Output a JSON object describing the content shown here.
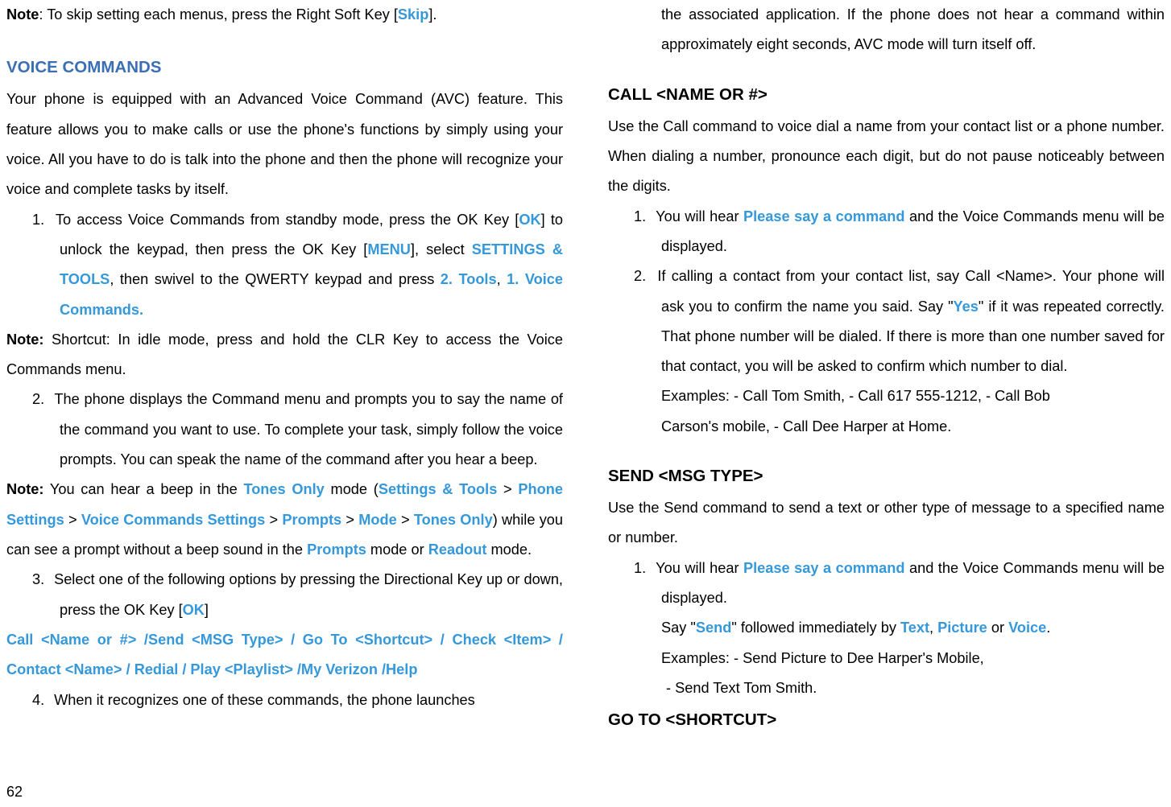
{
  "left": {
    "note1_label": "Note",
    "note1_rest": ": To skip setting each menus, press the Right Soft Key [",
    "note1_skip": "Skip",
    "note1_end": "].",
    "h_voice": "VOICE COMMANDS",
    "intro": "Your phone is equipped with an Advanced Voice Command (AVC) feature. This feature allows you to make calls or use the phone's functions by simply using your voice. All you have to do is talk into the phone and then the phone will recognize your voice and complete tasks by itself.",
    "li1_num": "1.",
    "li1_a": "To access Voice Commands from standby mode, press the OK Key [",
    "li1_ok": "OK",
    "li1_b": "] to unlock the keypad, then press the OK Key [",
    "li1_menu": "MENU",
    "li1_c": "], select ",
    "li1_settings": "SETTINGS & TOOLS",
    "li1_d": ", then swivel to the QWERTY keypad and press ",
    "li1_tools": "2. Tools",
    "li1_comma": ", ",
    "li1_vc": "1. Voice Commands.",
    "note2_label": "Note:",
    "note2_rest": " Shortcut: In idle mode, press and hold the CLR Key to access the Voice Commands menu.",
    "li2_num": "2.",
    "li2_text": "The phone displays the Command menu and prompts you to say the name of the command you want to use. To complete your task, simply follow the voice prompts. You can speak the name of the command after you hear a beep.",
    "note3_label": "Note:",
    "note3_a": " You can hear a beep in the ",
    "note3_tones1": "Tones Only",
    "note3_b": " mode (",
    "note3_st": "Settings & Tools",
    "note3_gt1": " > ",
    "note3_ps": "Phone Settings",
    "note3_gt2": " > ",
    "note3_vcs": "Voice Commands Settings",
    "note3_gt3": " > ",
    "note3_pr": "Prompts",
    "note3_gt4": " > ",
    "note3_mode": "Mode",
    "note3_gt5": " > ",
    "note3_tones2": "Tones Only",
    "note3_c": ") while you can see a prompt without a beep sound in the ",
    "note3_prompts2": "Prompts",
    "note3_d": " mode or ",
    "note3_readout": "Readout",
    "note3_e": " mode.",
    "li3_num": "3.",
    "li3_a": "Select one of the following options by pressing the Directional Key up or down, press the OK Key [",
    "li3_ok": "OK",
    "li3_b": "]",
    "cmdline": "Call <Name or #> /Send <MSG Type> / Go To <Shortcut> / Check <Item> / Contact <Name> / Redial / Play <Playlist> /My Verizon /Help",
    "li4_num": "4.",
    "li4_text": "When it recognizes one of these commands, the phone launches"
  },
  "right": {
    "cont": "the associated application. If the phone does not hear a command within approximately eight seconds, AVC mode will turn itself off.",
    "h_call": "CALL <NAME OR #>",
    "call_intro": "Use the Call command to voice dial a name from your contact list or a phone number. When dialing a number, pronounce each digit, but do not pause noticeably between the digits.",
    "c_li1_num": "1.",
    "c_li1_a": "You will hear ",
    "c_li1_cmd": "Please say a command",
    "c_li1_b": " and the Voice Commands menu will be displayed.",
    "c_li2_num": "2.",
    "c_li2_a": "If calling a contact from your contact list, say Call <Name>. Your phone will ask you to confirm the name you said. Say \"",
    "c_li2_yes": "Yes",
    "c_li2_b": "\" if it was repeated correctly. That phone number will be dialed. If there is more than one number saved for that contact, you will be asked to confirm which number to dial.",
    "c_ex1": "Examples: - Call Tom Smith, - Call 617 555-1212, - Call Bob",
    "c_ex2": "Carson's mobile, - Call Dee Harper at Home.",
    "h_send": "SEND <MSG TYPE>",
    "send_intro": "Use the Send command to send a text or other type of message to a specified name or number.",
    "s_li1_num": "1.",
    "s_li1_a": "You will hear ",
    "s_li1_cmd": "Please say a command",
    "s_li1_b": " and the Voice Commands menu will be displayed.",
    "s_say_a": "Say \"",
    "s_say_send": "Send",
    "s_say_b": "\" followed immediately by ",
    "s_text": "Text",
    "s_comma1": ", ",
    "s_picture": "Picture",
    "s_or": " or ",
    "s_voice": "Voice",
    "s_period": ".",
    "s_ex1": "Examples: - Send Picture to Dee Harper's Mobile,",
    "s_ex2": " - Send Text Tom Smith.",
    "h_goto": "GO TO <SHORTCUT>"
  },
  "page_number": "62"
}
